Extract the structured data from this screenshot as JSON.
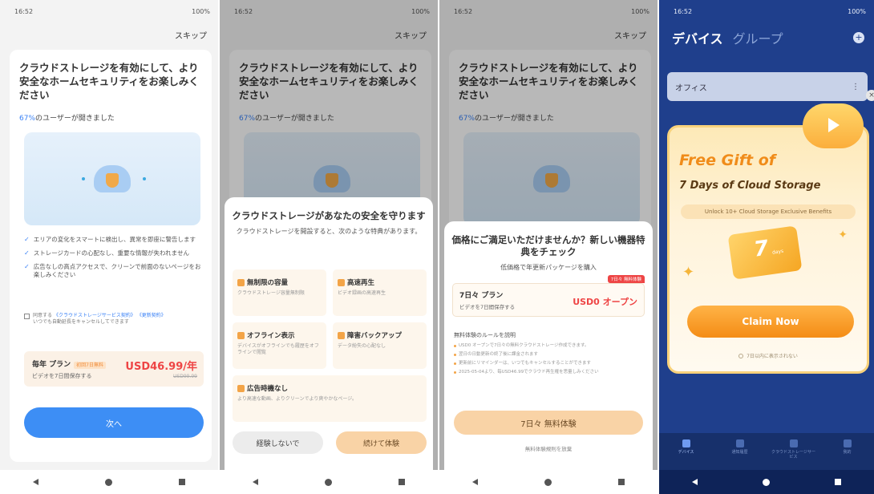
{
  "status": {
    "time": "16:52",
    "battery": "100%"
  },
  "skip_label": "スキップ",
  "promo": {
    "headline": "クラウドストレージを有効にして、より安全なホームセキュリティをお楽しみください",
    "users_pct": "67%",
    "users_text": "のユーザーが開きました"
  },
  "screen1": {
    "features": [
      "エリアの変化をスマートに検出し、異常を即座に警告します",
      "ストレージカードの心配なし、重要な情報が失われません",
      "広告なしの高点アクセスで、クリーンで前面のないページをお楽しみください"
    ],
    "agree_prefix": "同意する",
    "agree_link1": "《クラウドストレージサービス契約》",
    "agree_link2": "《更新契約》",
    "agree_suffix": "いつでも自動延長をキャンセルしてできます",
    "plan_name": "毎年 プラン",
    "plan_tag": "初回7日無料",
    "plan_sub": "ビデオを7日間保存する",
    "plan_price": "USD46.99/年",
    "plan_old_price": "USD99.99",
    "next_label": "次へ"
  },
  "screen2": {
    "title": "クラウドストレージがあなたの安全を守ります",
    "subtitle": "クラウドストレージを開設すると、次のような特典があります。",
    "benefits": [
      {
        "title": "無制限の容量",
        "desc": "クラウドストレージ容量無制限"
      },
      {
        "title": "高速再生",
        "desc": "ビデオ録画の高速再生"
      },
      {
        "title": "オフライン表示",
        "desc": "デバイスがオフラインでも履歴をオフラインで閲覧"
      },
      {
        "title": "障害バックアップ",
        "desc": "データ紛失の心配なし"
      },
      {
        "title": "広告時機なし",
        "desc": "より高速な動画、よりクリーンでより爽やかなページ。"
      }
    ],
    "btn_decline": "経験しないで",
    "btn_continue": "続けて体験"
  },
  "screen3": {
    "title": "価格にご満足いただけませんか？新しい機器特典をチェック",
    "subtitle": "低価格で年更新パッケージを購入",
    "plan_badge": "7日々 無料体験",
    "plan_name": "7日々 プラン",
    "plan_sub": "ビデオを7日間保存する",
    "plan_price": "USD0 オープン",
    "rules_title": "無料体験のルールを説明",
    "rules": [
      "USD0 オープンで7日々の無料クラウドストレージ作成できます。",
      "翌日の日動更新の終了後に課金されます",
      "更新前にリマインダーは、いつでもキャンセルすることができます",
      "2025-05-04より、毎USD46.99でクラウド再生権を思量しみください"
    ],
    "trial_btn": "7日々 無料体験",
    "trial_link": "無料体験規則を放棄"
  },
  "screen4": {
    "tab_devices": "デバイス",
    "tab_groups": "グループ",
    "device_name": "オフィス",
    "gift_line1": "Free Gift of",
    "gift_line2": "7 Days of Cloud Storage",
    "gift_unlock": "Unlock 10+ Cloud Storage Exclusive Benefits",
    "ticket_days": "7",
    "ticket_unit": "days",
    "claim_label": "Claim Now",
    "note": "7日以内に表示されない",
    "nav": [
      {
        "label": "デバイス",
        "active": true
      },
      {
        "label": "通知履歴",
        "active": false
      },
      {
        "label": "クラウドストレージサービス",
        "active": false
      },
      {
        "label": "我的",
        "active": false
      }
    ]
  },
  "colors": {
    "accent_blue": "#3d8ef5",
    "price_red": "#ee4545",
    "orange": "#f48c15",
    "app_blue": "#1f3f8c"
  }
}
